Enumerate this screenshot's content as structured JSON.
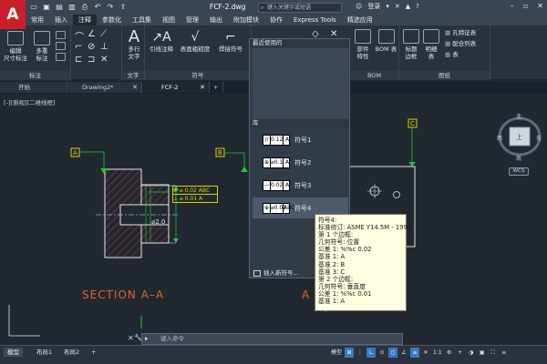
{
  "app": {
    "logo": "A",
    "document_title": "FCF-2.dwg"
  },
  "titlebar": {
    "search_placeholder": "键入关键字或短语",
    "login_label": "登录",
    "qat_icons": [
      "new-icon",
      "open-icon",
      "save-icon",
      "saveas-icon",
      "print-icon",
      "undo-icon",
      "redo-icon",
      "share-icon"
    ]
  },
  "menu": {
    "items": [
      "常用",
      "插入",
      "注释",
      "参数化",
      "工具集",
      "视图",
      "管理",
      "输出",
      "附加模块",
      "协作",
      "Express Tools",
      "精选应用"
    ],
    "active_index": 2
  },
  "ribbon": {
    "groups": {
      "annotation": {
        "label": "标注",
        "buttons": [
          {
            "line1": "编辑",
            "line2": "尺寸标注"
          },
          {
            "line1": "多重",
            "line2": "标注"
          }
        ]
      },
      "text": {
        "label": "文字",
        "button": {
          "line1": "多行",
          "line2": "文字"
        }
      },
      "symbol": {
        "label": "符号",
        "buttons": [
          "引线注释",
          "表面粗糙度",
          "焊接符号"
        ]
      },
      "bom": {
        "label": "BOM",
        "buttons": [
          {
            "line1": "部件",
            "line2": "特性"
          },
          {
            "line1": "BOM 表",
            "line2": ""
          }
        ]
      },
      "drawing": {
        "label": "图纸",
        "buttons": [
          {
            "line1": "标题",
            "line2": "边框"
          },
          {
            "line1": "明细",
            "line2": "表"
          }
        ],
        "list_items": [
          "孔特征表",
          "配合列表",
          "表"
        ]
      }
    }
  },
  "doc_tabs": {
    "items": [
      {
        "label": "开始",
        "closable": false
      },
      {
        "label": "Drawing2*",
        "closable": true
      },
      {
        "label": "FCF-2",
        "closable": true
      }
    ],
    "active_index": 2,
    "new_tab": "+"
  },
  "canvas": {
    "viewport_label": "[-][俯视][二维线框]",
    "section_label": "SECTION  A–A",
    "section_label_right": "A",
    "datum_labels": [
      "A",
      "B",
      "C"
    ],
    "dimension_text": "⌀2.0",
    "fcf_on_drawing": [
      {
        "symbol": "⊕",
        "value": "⌀ 0.02",
        "datums": [
          "A",
          "B",
          "C"
        ]
      },
      {
        "symbol": "⊥",
        "value": "⌀ 0.01",
        "datums": [
          "A"
        ]
      }
    ]
  },
  "navigation": {
    "compass_north": "北",
    "compass_south": "南",
    "compass_east": "东",
    "compass_west": "西",
    "cube_face": "上",
    "wcs_label": "WCS"
  },
  "dropdown": {
    "recent_header": "最近使用的",
    "library_header": "库",
    "symbols": [
      {
        "label": "符号1",
        "cells": [
          "//",
          "0.12",
          "A"
        ]
      },
      {
        "label": "符号2",
        "cells": [
          "⊕",
          "⌀0.1",
          "A"
        ]
      },
      {
        "label": "符号3",
        "cells": [
          "—",
          "0.02",
          "A"
        ]
      },
      {
        "label": "符号4",
        "cells": [
          "⊕",
          "⌀0.02",
          "ABC"
        ]
      }
    ],
    "hover_index": 3,
    "insert_label": "插入新符号..."
  },
  "tooltip": {
    "lines": [
      "符号4:",
      "标准修订: ASME Y14.5M - 1994",
      "第 1 个边框:",
      "  几何符号: 位置",
      "  公差 1: %%c 0.02",
      "  基准 1: A",
      "  基准 2: B",
      "  基准 3: C",
      "第 2 个边框:",
      "  几何符号: 垂直度",
      "  公差 1: %%c 0.01",
      "  基准 1: A"
    ]
  },
  "command_line": {
    "placeholder": "键入命令"
  },
  "status_bar": {
    "layout_tabs": [
      "模型",
      "布局1",
      "布局2"
    ],
    "active_index": 0,
    "add": "+",
    "model_label": "模型",
    "scale_label": "1:1"
  },
  "colors": {
    "background": "#212830",
    "ribbon": "#29313d",
    "accent_green": "#1fc83a",
    "datum_yellow": "#d9d100",
    "section_red": "#c4343c",
    "section_label": "#e0642a"
  }
}
